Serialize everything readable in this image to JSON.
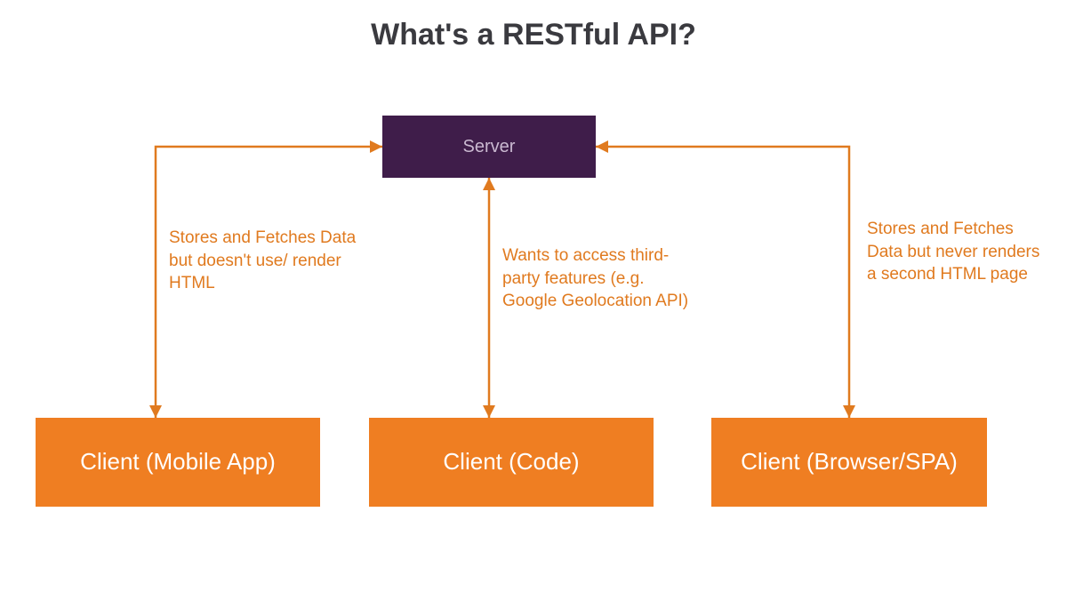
{
  "title": "What's a RESTful API?",
  "server": {
    "label": "Server"
  },
  "clients": [
    {
      "label": "Client (Mobile App)",
      "note": "Stores and Fetches Data but doesn't use/ render HTML"
    },
    {
      "label": "Client (Code)",
      "note": "Wants to access third-party features (e.g. Google Geolocation API)"
    },
    {
      "label": "Client (Browser/SPA)",
      "note": "Stores and Fetches Data but never renders a second HTML page"
    }
  ],
  "colors": {
    "accent_orange": "#ef7e22",
    "server_purple": "#3f1d4a",
    "title_dark": "#3a3a3f",
    "note_orange": "#e07a1f"
  }
}
